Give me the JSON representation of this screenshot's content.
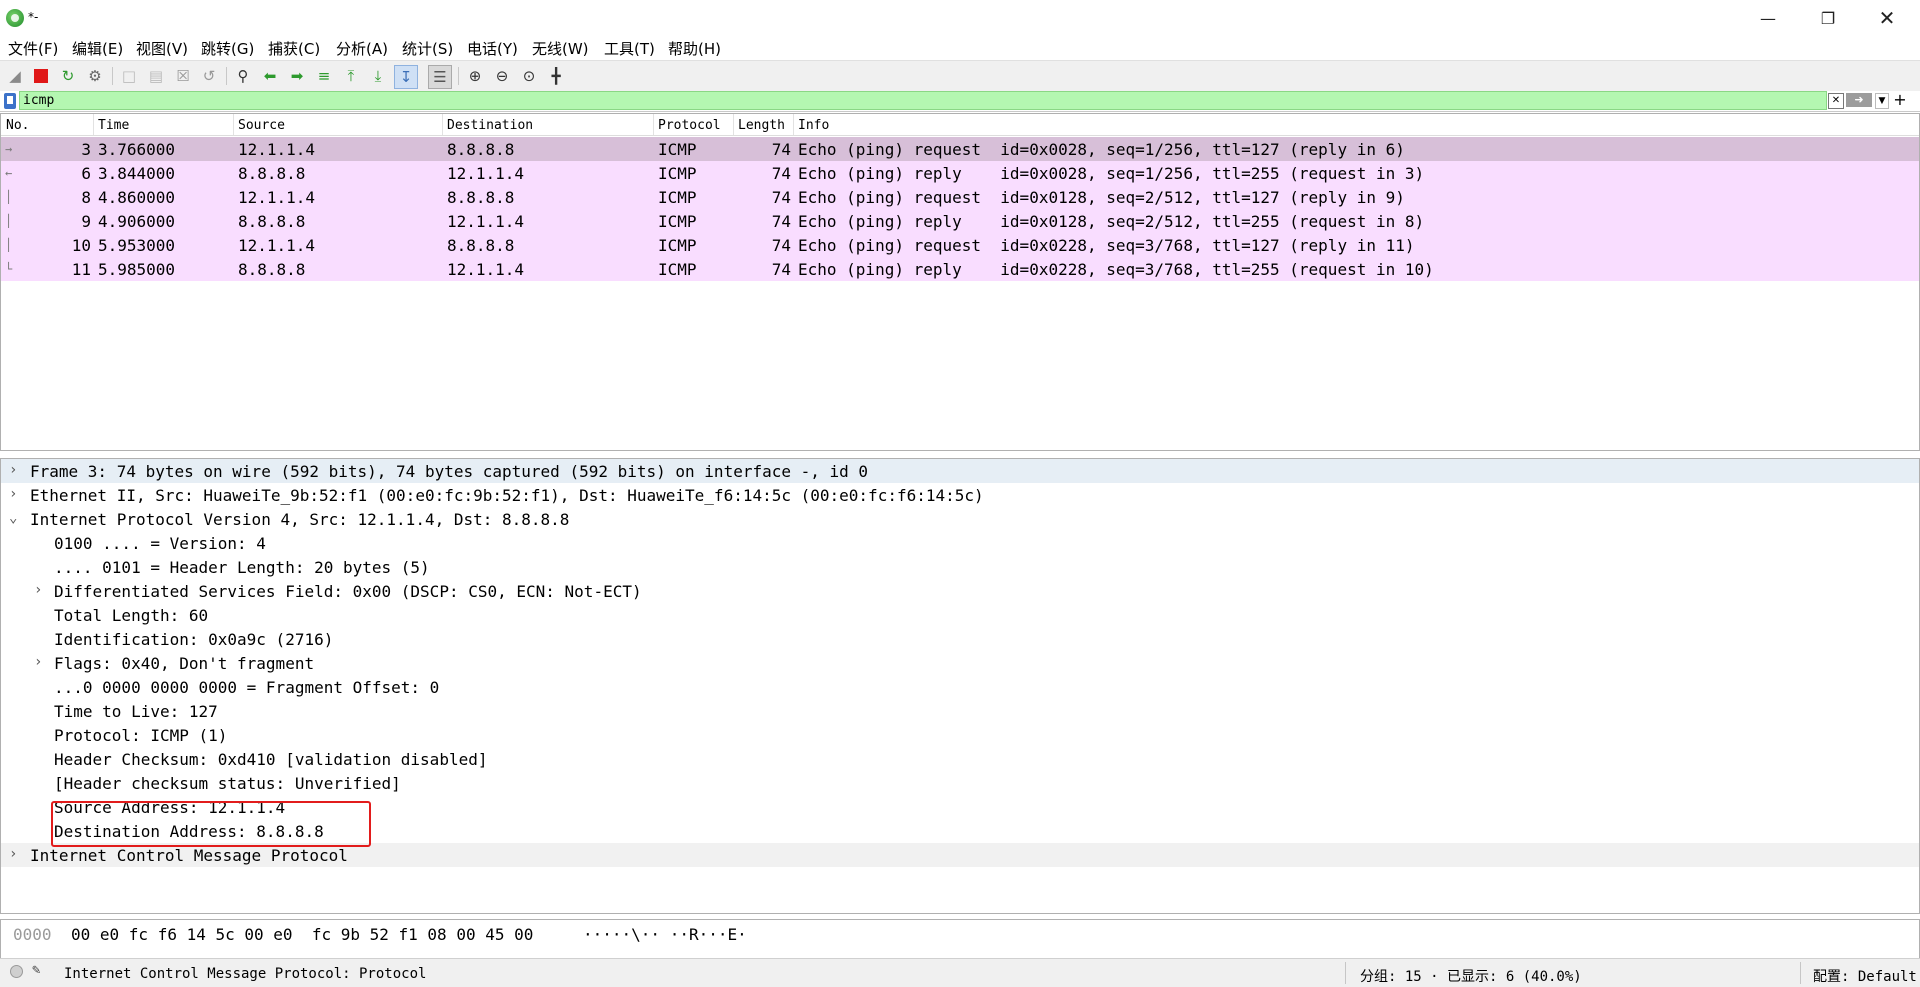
{
  "window": {
    "title": "*-",
    "min_icon": "minimize-icon",
    "max_icon": "restore-icon",
    "close_icon": "close-icon"
  },
  "menu": [
    "文件(F)",
    "编辑(E)",
    "视图(V)",
    "跳转(G)",
    "捕获(C)",
    "分析(A)",
    "统计(S)",
    "电话(Y)",
    "无线(W)",
    "工具(T)",
    "帮助(H)"
  ],
  "toolbar": {
    "icons": [
      "start-capture-icon",
      "stop-capture-icon",
      "restart-capture-icon",
      "capture-options-icon",
      "open-file-icon",
      "save-file-icon",
      "close-file-icon",
      "reload-file-icon",
      "find-packet-icon",
      "go-back-icon",
      "go-forward-icon",
      "go-to-packet-icon",
      "first-packet-icon",
      "last-packet-icon",
      "auto-scroll-icon",
      "colorize-icon",
      "zoom-in-icon",
      "zoom-out-icon",
      "zoom-reset-icon",
      "resize-columns-icon"
    ]
  },
  "filter": {
    "value": "icmp",
    "clear_icon": "clear-filter-icon",
    "apply_icon": "apply-filter-icon",
    "history_icon": "filter-history-icon",
    "add_icon": "add-filter-button-icon"
  },
  "packet_list": {
    "headers": [
      "No.",
      "Time",
      "Source",
      "Destination",
      "Protocol",
      "Length",
      "Info"
    ],
    "rows": [
      {
        "no": "3",
        "time": "3.766000",
        "src": "12.1.1.4",
        "dst": "8.8.8.8",
        "proto": "ICMP",
        "len": "74",
        "info": "Echo (ping) request  id=0x0028, seq=1/256, ttl=127 (reply in 6)"
      },
      {
        "no": "6",
        "time": "3.844000",
        "src": "8.8.8.8",
        "dst": "12.1.1.4",
        "proto": "ICMP",
        "len": "74",
        "info": "Echo (ping) reply    id=0x0028, seq=1/256, ttl=255 (request in 3)"
      },
      {
        "no": "8",
        "time": "4.860000",
        "src": "12.1.1.4",
        "dst": "8.8.8.8",
        "proto": "ICMP",
        "len": "74",
        "info": "Echo (ping) request  id=0x0128, seq=2/512, ttl=127 (reply in 9)"
      },
      {
        "no": "9",
        "time": "4.906000",
        "src": "8.8.8.8",
        "dst": "12.1.1.4",
        "proto": "ICMP",
        "len": "74",
        "info": "Echo (ping) reply    id=0x0128, seq=2/512, ttl=255 (request in 8)"
      },
      {
        "no": "10",
        "time": "5.953000",
        "src": "12.1.1.4",
        "dst": "8.8.8.8",
        "proto": "ICMP",
        "len": "74",
        "info": "Echo (ping) request  id=0x0228, seq=3/768, ttl=127 (reply in 11)"
      },
      {
        "no": "11",
        "time": "5.985000",
        "src": "8.8.8.8",
        "dst": "12.1.1.4",
        "proto": "ICMP",
        "len": "74",
        "info": "Echo (ping) reply    id=0x0228, seq=3/768, ttl=255 (request in 10)"
      }
    ]
  },
  "details": [
    {
      "text": "Frame 3: 74 bytes on wire (592 bits), 74 bytes captured (592 bits) on interface -, id 0",
      "arrow": "›"
    },
    {
      "text": "Ethernet II, Src: HuaweiTe_9b:52:f1 (00:e0:fc:9b:52:f1), Dst: HuaweiTe_f6:14:5c (00:e0:fc:f6:14:5c)",
      "arrow": "›"
    },
    {
      "text": "Internet Protocol Version 4, Src: 12.1.1.4, Dst: 8.8.8.8",
      "arrow": "⌄"
    },
    {
      "text": "0100 .... = Version: 4",
      "arrow": ""
    },
    {
      "text": ".... 0101 = Header Length: 20 bytes (5)",
      "arrow": ""
    },
    {
      "text": "Differentiated Services Field: 0x00 (DSCP: CS0, ECN: Not-ECT)",
      "arrow": "›"
    },
    {
      "text": "Total Length: 60",
      "arrow": ""
    },
    {
      "text": "Identification: 0x0a9c (2716)",
      "arrow": ""
    },
    {
      "text": "Flags: 0x40, Don't fragment",
      "arrow": "›"
    },
    {
      "text": "...0 0000 0000 0000 = Fragment Offset: 0",
      "arrow": ""
    },
    {
      "text": "Time to Live: 127",
      "arrow": ""
    },
    {
      "text": "Protocol: ICMP (1)",
      "arrow": ""
    },
    {
      "text": "Header Checksum: 0xd410 [validation disabled]",
      "arrow": ""
    },
    {
      "text": "[Header checksum status: Unverified]",
      "arrow": ""
    },
    {
      "text": "Source Address: 12.1.1.4",
      "arrow": ""
    },
    {
      "text": "Destination Address: 8.8.8.8",
      "arrow": ""
    },
    {
      "text": "Internet Control Message Protocol",
      "arrow": "›"
    }
  ],
  "bytes": {
    "offset": "0000",
    "hex": "00 e0 fc f6 14 5c 00 e0  fc 9b 52 f1 08 00 45 00",
    "ascii": "·····\\·· ··R···E·"
  },
  "status": {
    "ready_icon": "capture-status-icon",
    "edit_icon": "edit-comment-icon",
    "text": "Internet Control Message Protocol: Protocol",
    "stats": "分组: 15 · 已显示: 6 (40.0%)",
    "profile": "配置: Default"
  }
}
